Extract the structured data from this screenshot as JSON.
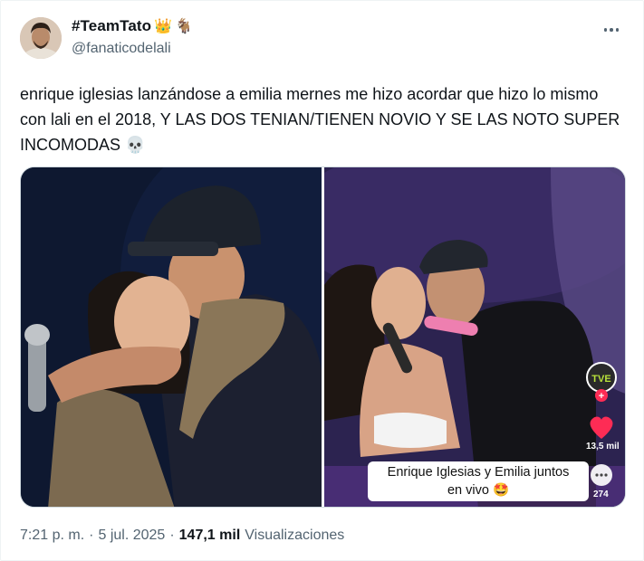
{
  "author": {
    "display_name": "#TeamTato",
    "badges": [
      "👑",
      "🐐"
    ],
    "handle": "@fanaticodelali"
  },
  "tweet": {
    "text": "enrique iglesias lanzándose a emilia mernes me hizo acordar que hizo lo mismo con lali en el 2018, Y LAS DOS TENIAN/TIENEN NOVIO Y SE LAS NOTO SUPER INCOMODAS 💀"
  },
  "media": {
    "right_photo": {
      "caption_line1": "Enrique Iglesias y Emilia juntos",
      "caption_line2": "en vivo 🤩",
      "likes": "13,5 mil",
      "comments": "274"
    }
  },
  "meta": {
    "time": "7:21 p. m.",
    "separator": "·",
    "date": "5 jul. 2025",
    "views_count": "147,1 mil",
    "views_label": "Visualizaciones"
  },
  "colors": {
    "secondary_text": "#536471",
    "primary_text": "#0f1419",
    "like_red": "#fe2c55"
  }
}
